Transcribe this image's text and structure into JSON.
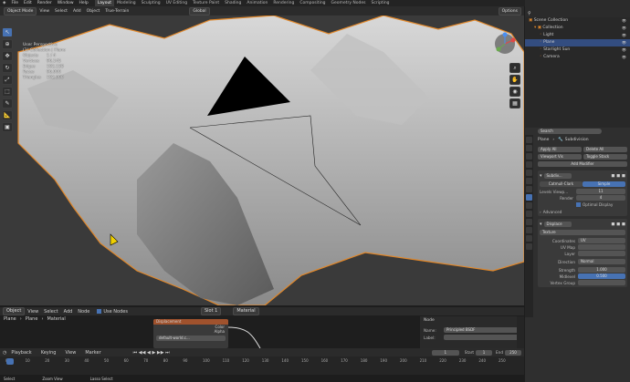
{
  "topbar": {
    "menus": [
      "File",
      "Edit",
      "Render",
      "Window",
      "Help"
    ],
    "tabs": [
      "Layout",
      "Modeling",
      "Sculpting",
      "UV Editing",
      "Texture Paint",
      "Shading",
      "Animation",
      "Rendering",
      "Compositing",
      "Geometry Nodes",
      "Scripting"
    ],
    "scene": "Scene",
    "view_layer": "ViewLayer"
  },
  "viewport_header": {
    "mode": "Object Mode",
    "menus": [
      "View",
      "Select",
      "Add",
      "Object",
      "True-Terrain"
    ],
    "orientation": "Global",
    "options": "Options"
  },
  "overlay": {
    "title": "User Perspective",
    "collection": "(1) Collection | Plane",
    "stats": [
      {
        "k": "Objects",
        "v": "1 / 4"
      },
      {
        "k": "Vertices",
        "v": "96,145"
      },
      {
        "k": "Edges",
        "v": "192,128"
      },
      {
        "k": "Faces",
        "v": "96,000"
      },
      {
        "k": "Triangles",
        "v": "192,000"
      }
    ]
  },
  "outliner": {
    "items": [
      {
        "label": "Scene Collection",
        "indent": 0
      },
      {
        "label": "Collection",
        "indent": 1
      },
      {
        "label": "Light",
        "indent": 2
      },
      {
        "label": "Plane",
        "indent": 2,
        "selected": true
      },
      {
        "label": "Starlight Sun",
        "indent": 2
      },
      {
        "label": "Camera",
        "indent": 2
      }
    ]
  },
  "properties": {
    "search": "Search",
    "object": "Plane",
    "modifier_tab": "Subdivision",
    "apply_all": "Apply All",
    "delete_all": "Delete All",
    "viewport_vis": "Viewport Vis",
    "toggle_stack": "Toggle Stack",
    "add_modifier": "Add Modifier",
    "subdiv": {
      "name": "Subdiv...",
      "catmull": "Catmull-Clark",
      "simple": "Simple",
      "levels_label": "Levels Viewp...",
      "levels": "11",
      "render_label": "Render",
      "render": "4",
      "optimal": "Optimal Display",
      "advanced": "Advanced"
    },
    "displace": {
      "name": "Displace",
      "texture": "Texture",
      "coords_label": "Coordinates",
      "coords": "UV",
      "uvmap_label": "UV Map",
      "layer_label": "Layer",
      "direction_label": "Direction",
      "direction": "Normal",
      "strength_label": "Strength",
      "strength": "1.000",
      "midlevel_label": "Midlevel",
      "midlevel": "0.500",
      "vgroup_label": "Vertex Group"
    }
  },
  "node_editor": {
    "mode": "Object",
    "menus": [
      "View",
      "Select",
      "Add",
      "Node"
    ],
    "use_nodes": "Use Nodes",
    "slot": "Slot 1",
    "material": "Material",
    "breadcrumb": [
      "Plane",
      "Plane",
      "Material"
    ],
    "node_title": "Displacement",
    "node_sockets": [
      "Color",
      "Alpha"
    ],
    "tex_name": "default-world.c...",
    "panel_title": "Node",
    "name_label": "Name:",
    "name_value": "Principled BSDF",
    "label_label": "Label:"
  },
  "timeline": {
    "menus": [
      "Playback",
      "Keying",
      "View",
      "Marker"
    ],
    "frame": "1",
    "start_label": "Start",
    "start": "1",
    "end_label": "End",
    "end": "250",
    "ticks": [
      "0",
      "10",
      "20",
      "30",
      "40",
      "50",
      "60",
      "70",
      "80",
      "90",
      "100",
      "110",
      "120",
      "130",
      "140",
      "150",
      "160",
      "170",
      "180",
      "190",
      "200",
      "210",
      "220",
      "230",
      "240",
      "250"
    ]
  },
  "status": {
    "select": "Select",
    "zoom": "Zoom View",
    "lasso": "Lasso Select"
  }
}
